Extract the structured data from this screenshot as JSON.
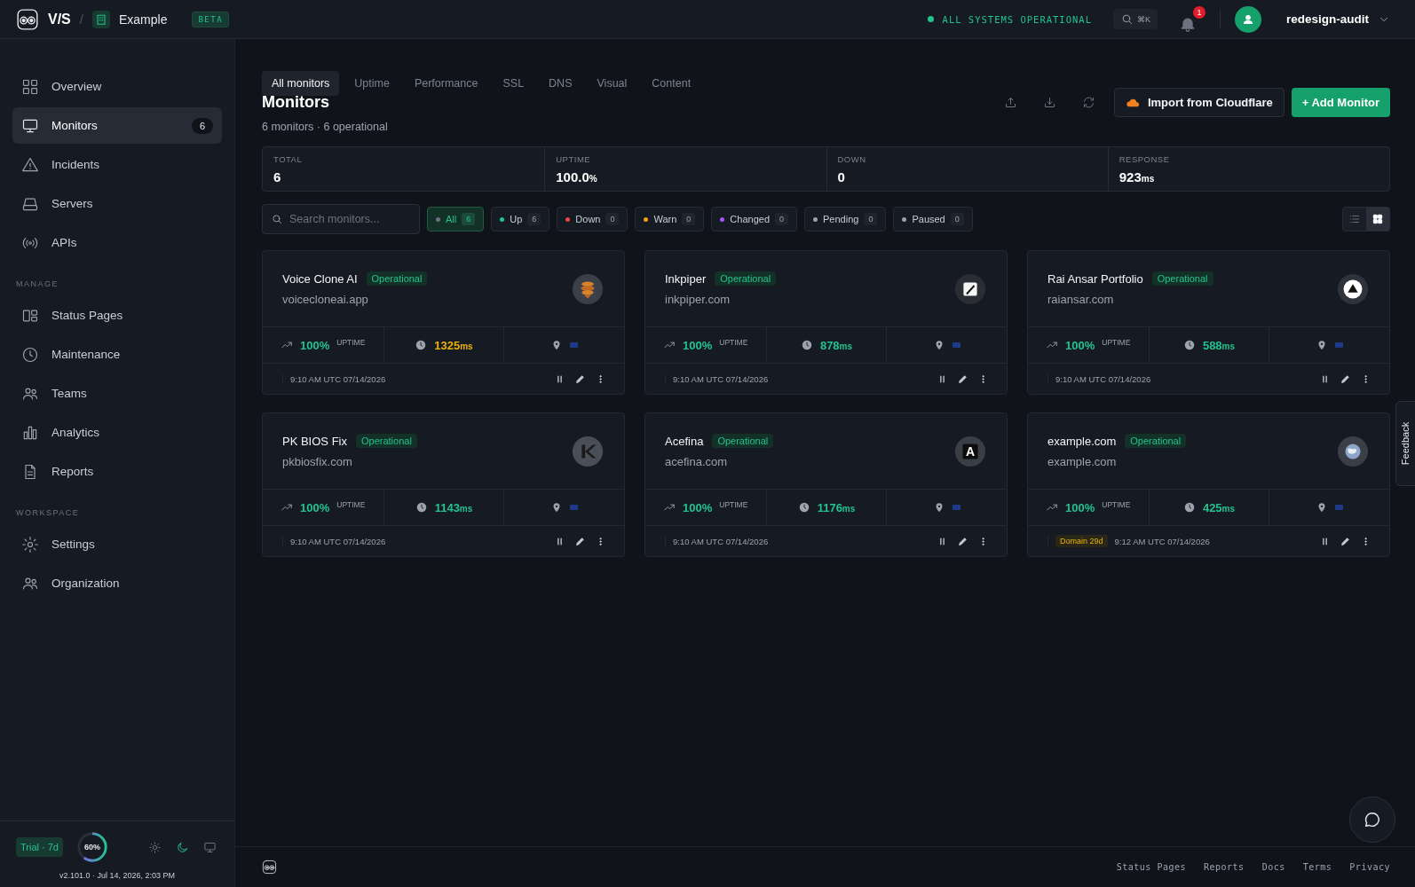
{
  "topbar": {
    "brand": "V/S",
    "separator": "/",
    "workspace": "Example",
    "badge": "BETA",
    "status": "ALL SYSTEMS OPERATIONAL",
    "search_shortcut": "⌘K",
    "notifications": "1",
    "user": "redesign-audit"
  },
  "sidebar": {
    "sections": [
      {
        "items": [
          {
            "label": "Overview",
            "kind": "grid",
            "selected": false
          },
          {
            "label": "Monitors",
            "kind": "monitor",
            "selected": true,
            "count": "6"
          },
          {
            "label": "Incidents",
            "kind": "warning",
            "selected": false
          },
          {
            "label": "Servers",
            "kind": "server",
            "selected": false
          },
          {
            "label": "APIs",
            "kind": "signal",
            "selected": false
          }
        ]
      },
      {
        "heading": "MANAGE",
        "items": [
          {
            "label": "Status Pages",
            "kind": "layout",
            "selected": false
          },
          {
            "label": "Maintenance",
            "kind": "clock",
            "selected": false
          },
          {
            "label": "Teams",
            "kind": "users",
            "selected": false
          },
          {
            "label": "Analytics",
            "kind": "bars",
            "selected": false
          },
          {
            "label": "Reports",
            "kind": "file",
            "selected": false
          }
        ]
      },
      {
        "heading": "WORKSPACE",
        "items": [
          {
            "label": "Settings",
            "kind": "gear",
            "selected": false
          },
          {
            "label": "Organization",
            "kind": "users",
            "selected": false
          }
        ]
      }
    ],
    "trial": "Trial · 7d",
    "usage": {
      "reading": "60%",
      "level": 0.6
    },
    "themes": [
      {
        "kind": "light",
        "selected": false
      },
      {
        "kind": "dark",
        "selected": true
      },
      {
        "kind": "system",
        "selected": false
      }
    ],
    "version": "v2.101.0 · Jul 14, 2026, 2:03 PM"
  },
  "tabs": [
    {
      "label": "All monitors",
      "selected": true
    },
    {
      "label": "Uptime",
      "selected": false
    },
    {
      "label": "Performance",
      "selected": false
    },
    {
      "label": "SSL",
      "selected": false
    },
    {
      "label": "DNS",
      "selected": false
    },
    {
      "label": "Visual",
      "selected": false
    },
    {
      "label": "Content",
      "selected": false
    }
  ],
  "header": {
    "title": "Monitors",
    "subtitle": "6 monitors · 6 operational",
    "actions": [
      {
        "kind": "upload"
      },
      {
        "kind": "download"
      },
      {
        "kind": "refresh"
      }
    ],
    "import_button": "Import from Cloudflare",
    "add_button": "+ Add Monitor"
  },
  "stats": [
    {
      "label": "TOTAL",
      "value": "6"
    },
    {
      "label": "UPTIME",
      "value": "100.0",
      "unit": "%"
    },
    {
      "label": "DOWN",
      "value": "0"
    },
    {
      "label": "RESPONSE",
      "value": "923",
      "unit": "ms"
    }
  ],
  "search": {
    "placeholder": "Search monitors..."
  },
  "filters": [
    {
      "label": "All",
      "count": "6",
      "color": "#6b7280",
      "selected": true
    },
    {
      "label": "Up",
      "count": "6",
      "color": "#22c38e",
      "selected": false
    },
    {
      "label": "Down",
      "count": "0",
      "color": "#ef4444",
      "selected": false
    },
    {
      "label": "Warn",
      "count": "0",
      "color": "#f59e0b",
      "selected": false
    },
    {
      "label": "Changed",
      "count": "0",
      "color": "#a855f7",
      "selected": false
    },
    {
      "label": "Pending",
      "count": "0",
      "color": "#9ca3af",
      "selected": false
    },
    {
      "label": "Paused",
      "count": "0",
      "color": "#9ca3af",
      "selected": false
    }
  ],
  "view_modes": [
    {
      "kind": "list",
      "selected": false
    },
    {
      "kind": "grid",
      "selected": true
    }
  ],
  "monitors": [
    {
      "name": "Voice Clone AI",
      "status": "Operational",
      "url": "voicecloneai.app",
      "logo": {
        "kind": "stack"
      },
      "uptime": "100%",
      "uptime_label": "UPTIME",
      "response": {
        "value": "1325",
        "unit": "ms",
        "color": "#eab308"
      },
      "checked": "9:10 AM UTC 07/14/2026"
    },
    {
      "name": "Inkpiper",
      "status": "Operational",
      "url": "inkpiper.com",
      "logo": {
        "kind": "pen"
      },
      "uptime": "100%",
      "uptime_label": "UPTIME",
      "response": {
        "value": "878",
        "unit": "ms",
        "color": "#22c38e"
      },
      "checked": "9:10 AM UTC 07/14/2026"
    },
    {
      "name": "Rai Ansar Portfolio",
      "status": "Operational",
      "url": "raiansar.com",
      "logo": {
        "kind": "triangle"
      },
      "uptime": "100%",
      "uptime_label": "UPTIME",
      "response": {
        "value": "588",
        "unit": "ms",
        "color": "#22c38e"
      },
      "checked": "9:10 AM UTC 07/14/2026"
    },
    {
      "name": "PK BIOS Fix",
      "status": "Operational",
      "url": "pkbiosfix.com",
      "logo": {
        "kind": "monogram"
      },
      "uptime": "100%",
      "uptime_label": "UPTIME",
      "response": {
        "value": "1143",
        "unit": "ms",
        "color": "#22c38e"
      },
      "checked": "9:10 AM UTC 07/14/2026"
    },
    {
      "name": "Acefina",
      "status": "Operational",
      "url": "acefina.com",
      "logo": {
        "kind": "letter",
        "text": "A"
      },
      "uptime": "100%",
      "uptime_label": "UPTIME",
      "response": {
        "value": "1176",
        "unit": "ms",
        "color": "#22c38e"
      },
      "checked": "9:10 AM UTC 07/14/2026"
    },
    {
      "name": "example.com",
      "status": "Operational",
      "url": "example.com",
      "logo": {
        "kind": "globe"
      },
      "uptime": "100%",
      "uptime_label": "UPTIME",
      "response": {
        "value": "425",
        "unit": "ms",
        "color": "#22c38e"
      },
      "domain_badge": "Domain 29d",
      "checked": "9:12 AM UTC 07/14/2026"
    }
  ],
  "footer": {
    "links": [
      "Status Pages",
      "Reports",
      "Docs",
      "Terms",
      "Privacy"
    ]
  },
  "feedback": "Feedback"
}
